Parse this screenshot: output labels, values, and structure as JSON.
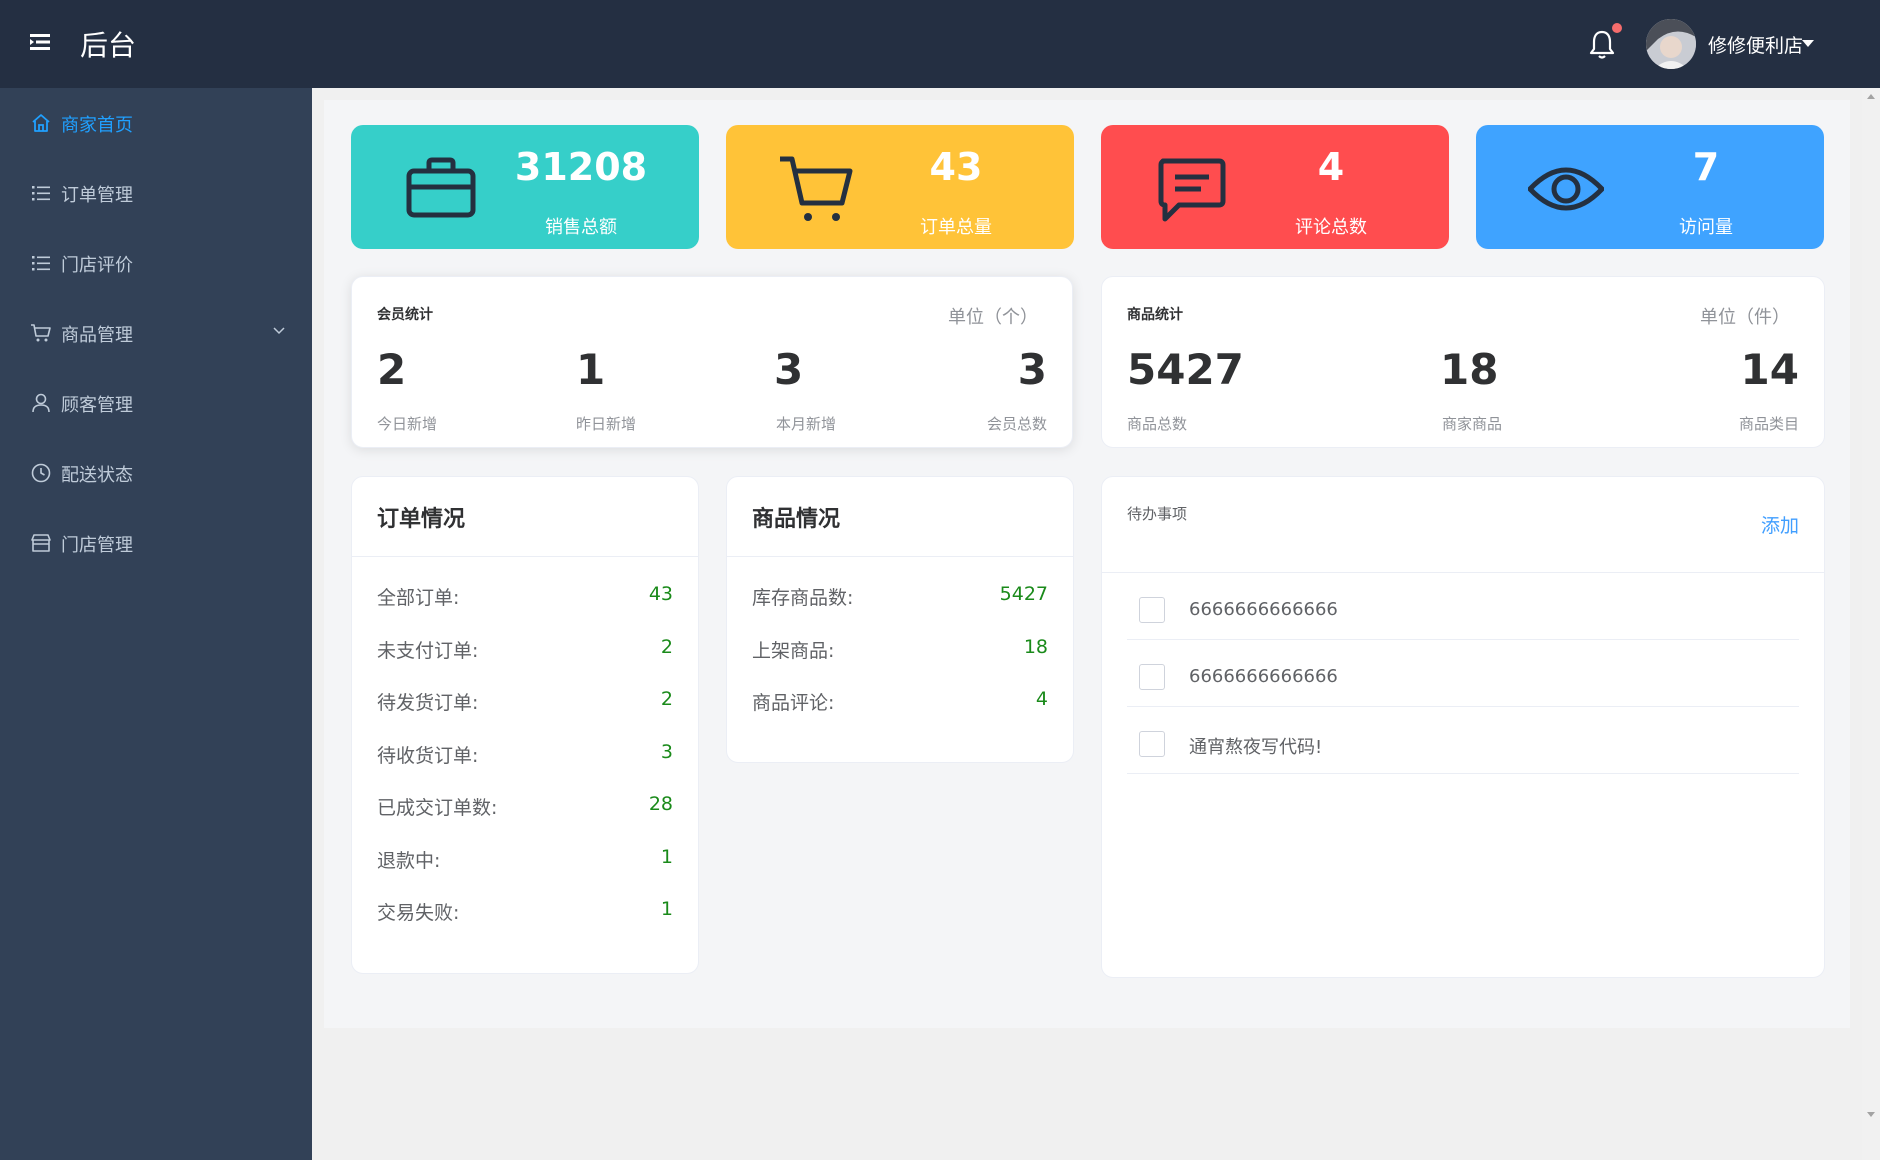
{
  "header": {
    "title": "后台",
    "user_name": "修修便利店"
  },
  "sidebar": {
    "items": [
      {
        "label": "商家首页",
        "icon": "home-icon",
        "active": true
      },
      {
        "label": "订单管理",
        "icon": "list-icon"
      },
      {
        "label": "门店评价",
        "icon": "list-icon"
      },
      {
        "label": "商品管理",
        "icon": "cart-icon",
        "expandable": true
      },
      {
        "label": "顾客管理",
        "icon": "user-icon"
      },
      {
        "label": "配送状态",
        "icon": "clock-icon"
      },
      {
        "label": "门店管理",
        "icon": "store-icon"
      }
    ]
  },
  "stats": [
    {
      "value": "31208",
      "label": "销售总额",
      "icon": "briefcase-icon",
      "color": "#36cfc9"
    },
    {
      "value": "43",
      "label": "订单总量",
      "icon": "cart-icon",
      "color": "#ffc338"
    },
    {
      "value": "4",
      "label": "评论总数",
      "icon": "message-icon",
      "color": "#ff4d4f"
    },
    {
      "value": "7",
      "label": "访问量",
      "icon": "eye-icon",
      "color": "#3fa3ff"
    }
  ],
  "member_stats": {
    "title": "会员统计",
    "unit": "单位（个）",
    "items": [
      {
        "value": "2",
        "label": "今日新增"
      },
      {
        "value": "1",
        "label": "昨日新增"
      },
      {
        "value": "3",
        "label": "本月新增"
      },
      {
        "value": "3",
        "label": "会员总数"
      }
    ]
  },
  "product_stats": {
    "title": "商品统计",
    "unit": "单位（件）",
    "items": [
      {
        "value": "5427",
        "label": "商品总数"
      },
      {
        "value": "18",
        "label": "商家商品"
      },
      {
        "value": "14",
        "label": "商品类目"
      }
    ]
  },
  "orders": {
    "title": "订单情况",
    "rows": [
      {
        "label": "全部订单:",
        "value": "43"
      },
      {
        "label": "未支付订单:",
        "value": "2"
      },
      {
        "label": "待发货订单:",
        "value": "2"
      },
      {
        "label": "待收货订单:",
        "value": "3"
      },
      {
        "label": "已成交订单数:",
        "value": "28"
      },
      {
        "label": "退款中:",
        "value": "1"
      },
      {
        "label": "交易失败:",
        "value": "1"
      }
    ]
  },
  "products": {
    "title": "商品情况",
    "rows": [
      {
        "label": "库存商品数:",
        "value": "5427"
      },
      {
        "label": "上架商品:",
        "value": "18"
      },
      {
        "label": "商品评论:",
        "value": "4"
      }
    ]
  },
  "todo": {
    "title": "待办事项",
    "add_label": "添加",
    "items": [
      {
        "text": "6666666666666",
        "checked": false
      },
      {
        "text": "6666666666666",
        "checked": false
      },
      {
        "text": "通宵熬夜写代码!",
        "checked": false
      }
    ]
  },
  "colors": {
    "header_bg": "#242f42",
    "sidebar_bg": "#324157",
    "active": "#20a0ff",
    "value_green": "#1a8a1a",
    "link_blue": "#409eff"
  }
}
